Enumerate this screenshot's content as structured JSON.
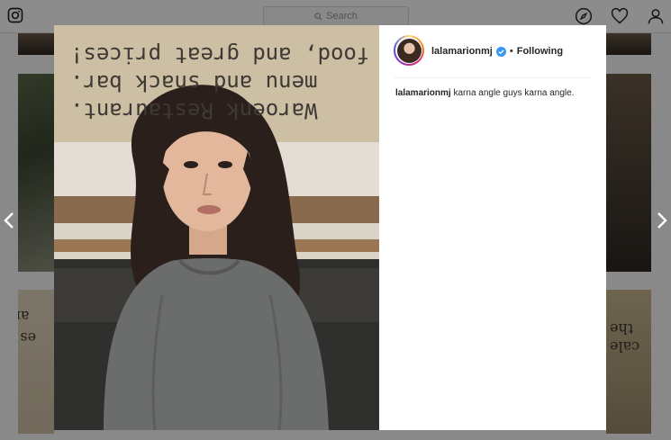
{
  "topbar": {
    "search_placeholder": "Search",
    "icons": [
      "instagram-icon",
      "search-icon",
      "explore-compass-icon",
      "heart-icon",
      "profile-icon"
    ]
  },
  "modal": {
    "photo": {
      "wall_text_lines": [
        "Waroenk Restaurant.",
        "menu and snack bar.",
        "food, and great prices!"
      ]
    },
    "header": {
      "username": "lalamarionmj",
      "separator": "•",
      "follow_status": "Following"
    },
    "caption": {
      "username": "lalamarionmj",
      "text": "karna angle guys karna angle."
    }
  },
  "colors": {
    "overlay": "#000000",
    "verified_blue": "#3897f0",
    "text": "#262626"
  }
}
